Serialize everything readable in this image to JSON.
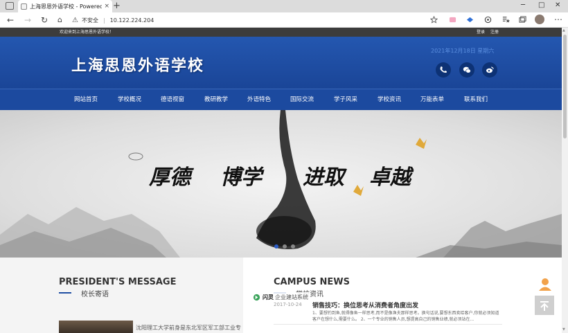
{
  "browser": {
    "tab_title": "上海思恩外语学校 - Powered by",
    "tab_close": "×",
    "new_tab": "+",
    "security_label": "不安全",
    "url": "10.122.224.204",
    "window_controls": {
      "minimize": "─",
      "maximize": "□",
      "close": "✕"
    }
  },
  "site": {
    "topbar": {
      "welcome": "欢迎来到上海思恩外语学校！",
      "login": "登录",
      "register": "注册"
    },
    "logo": "上海思恩外语学校",
    "date": "2021年12月18日  星期六",
    "nav": [
      "网站首页",
      "学校概况",
      "德语视窗",
      "教研教学",
      "外语特色",
      "国际交流",
      "学子风采",
      "学校资讯",
      "万能表单",
      "联系我们"
    ],
    "banner": {
      "slogan": [
        "厚德",
        "博学",
        "进取",
        "卓越"
      ],
      "slide_count": 3,
      "active_slide": 1
    },
    "president": {
      "title_en": "PRESIDENT'S MESSAGE",
      "title_cn": "校长寄语",
      "text": "沈阳理工大学前身是东北军区军工部工业专"
    },
    "news": {
      "title_en": "CAMPUS NEWS",
      "title_cn": "学校资讯",
      "items": [
        {
          "date": "2017-10-24",
          "title": "销售技巧：换位思考从消费者角度出发",
          "summary": "1、要想钓到鱼,就得像鱼一样思考,而不是像渔夫那样思考。换句话说,要想东西卖给客户,你就必须知道客户在想什么,需要什么。    2、一个专业的销售人员,想提高自己的销售业绩,就必须站在..."
        }
      ]
    },
    "badge": {
      "brand": "闪灵",
      "text": "企业建站系统"
    }
  },
  "colors": {
    "header_blue": "#1f4ea3",
    "topbar": "#3c3c3c",
    "social_bg": "#0d3275"
  }
}
